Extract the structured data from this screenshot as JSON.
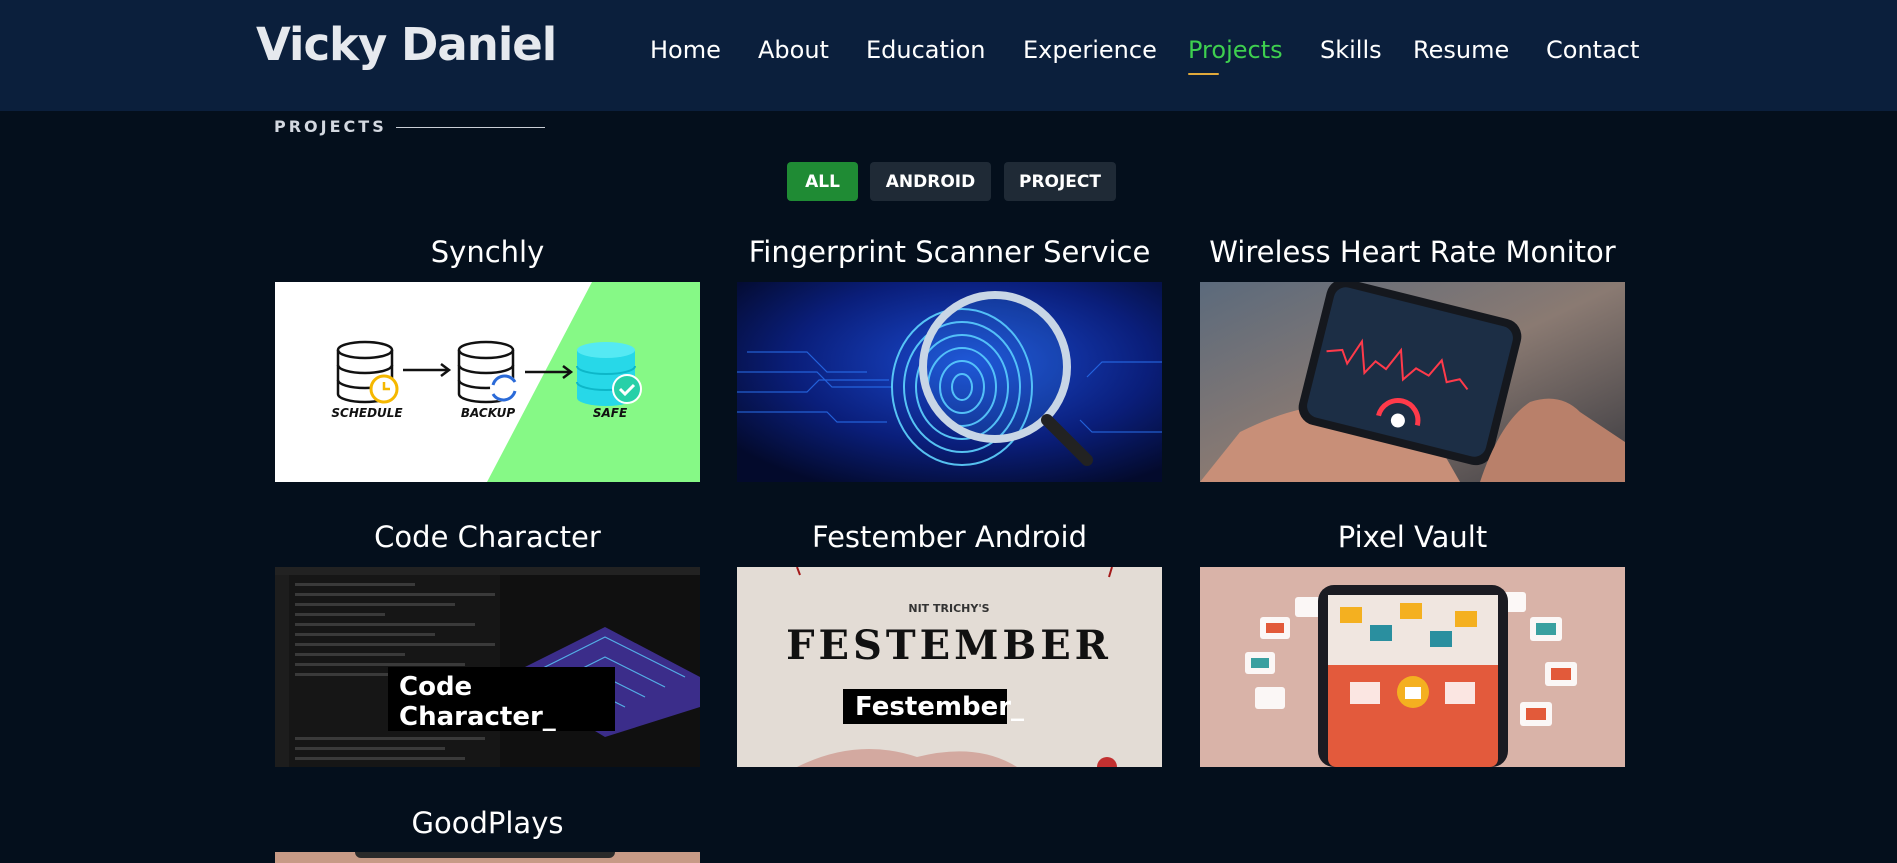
{
  "header": {
    "logo": "Vicky Daniel",
    "nav": [
      {
        "label": "Home",
        "active": false
      },
      {
        "label": "About",
        "active": false
      },
      {
        "label": "Education",
        "active": false
      },
      {
        "label": "Experience",
        "active": false
      },
      {
        "label": "Projects",
        "active": true
      },
      {
        "label": "Skills",
        "active": false
      },
      {
        "label": "Resume",
        "active": false
      },
      {
        "label": "Contact",
        "active": false
      }
    ]
  },
  "section": {
    "title": "PROJECTS"
  },
  "filters": [
    {
      "label": "ALL",
      "active": true
    },
    {
      "label": "ANDROID",
      "active": false
    },
    {
      "label": "PROJECT",
      "active": false
    }
  ],
  "projects": [
    {
      "title": "Synchly",
      "image_text": [
        "SCHEDULE",
        "BACKUP",
        "SAFE"
      ]
    },
    {
      "title": "Fingerprint Scanner Service"
    },
    {
      "title": "Wireless Heart Rate Monitor"
    },
    {
      "title": "Code Character",
      "image_text": [
        "Code",
        "Character_"
      ]
    },
    {
      "title": "Festember Android",
      "image_text": [
        "NIT TRICHY'S",
        "FESTEMBER",
        "Festember_"
      ]
    },
    {
      "title": "Pixel Vault"
    },
    {
      "title": "GoodPlays"
    }
  ],
  "colors": {
    "background": "#040f1c",
    "header": "#0b1f3c",
    "accent_green": "#3ecf4f",
    "button_active": "#1f8b34",
    "button_inactive": "#1f2a36"
  }
}
